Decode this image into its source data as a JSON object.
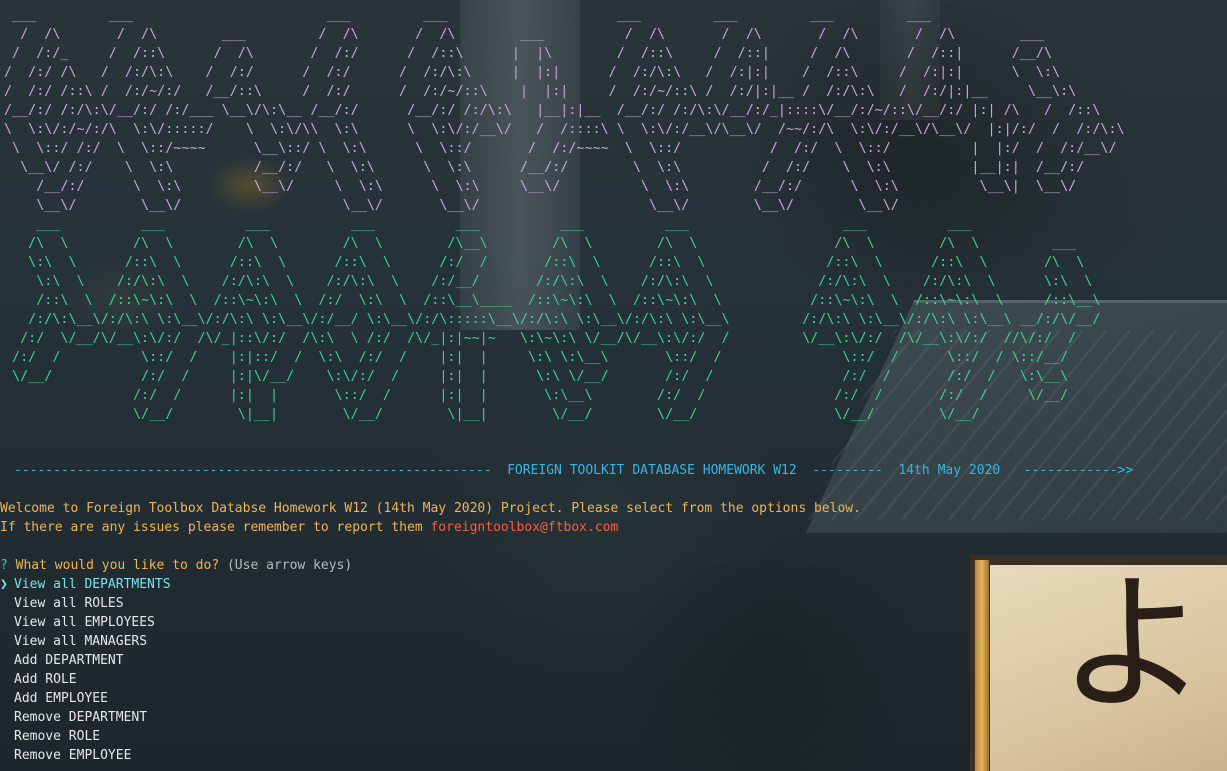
{
  "colors": {
    "ascii_top": "#c9a3e0",
    "ascii_bottom": "#3cd38a",
    "divider": "#36b7e2",
    "welcome": "#f0b455",
    "email": "#ff5c3c",
    "prompt_mark": "#3cd38a",
    "prompt_question": "#f0b455",
    "hint": "#b8b8b8",
    "selected": "#7fe0ea",
    "text": "#e8e8e8",
    "background_lantern_text": "#2a1f18"
  },
  "banner_top": " ___         ___                        ___         ___                     ___         ___         ___         ___\n  /  /\\       /  /\\        ___         /  /\\       /  /\\        ___          /  /\\       /  /\\       /  /\\       /  /\\        ___\n /  /:/_     /  /::\\      /  /\\       /  /:/      /  /::\\      |  |\\        /  /::\\     /  /::|     /  /\\       /  /::|      /__/\\\n/  /:/ /\\   /  /:/\\:\\    /  /:/      /  /:/      /  /:/\\:\\     |  |:|      /  /:/\\:\\   /  /:|:|    /  /::\\     /  /:|:|      \\  \\:\\\n/  /:/ /::\\ /  /:/~/:/   /__/::\\     /  /:/      /  /:/~/::\\    |  |:|     /  /:/~/::\\ /  /:/|:|__ /  /:/\\:\\   /  /:/|:|__     \\__\\:\\\n/__/:/ /:/\\:\\/__/:/ /:/___ \\__\\/\\:\\__ /__/:/      /__/:/ /:/\\:\\   |__|:|__  /__/:/ /:/\\:\\/__/:/_|::::\\/__/:/~/::\\/__/:/ |:| /\\   /  /::\\\n\\  \\:\\/:/~/:/\\  \\:\\/:::::/    \\  \\:\\/\\\\  \\:\\      \\  \\:\\/:/__\\/   /  /::::\\ \\  \\:\\/:/__\\/\\__\\/  /~~/:/\\  \\:\\/:/__\\/\\__\\/  |:|/:/  /  /:/\\:\\\n \\  \\::/ /:/  \\  \\::/~~~~      \\__\\::/ \\  \\:\\      \\  \\::/       /  /:/~~~~  \\  \\::/           /  /:/  \\  \\::/          |  |:/  /  /:/__\\/\n  \\__\\/ /:/    \\  \\:\\          /__/:/   \\  \\:\\      \\  \\:\\      /__/:/        \\  \\:\\          /  /:/    \\  \\:\\          |__|:|  /__/:/\n    /__/:/      \\  \\:\\         \\__\\/     \\  \\:\\      \\  \\:\\     \\__\\/          \\  \\:\\        /__/:/      \\  \\:\\          \\__\\|  \\__\\/\n    \\__\\/        \\__\\/                    \\__\\/       \\__\\/                     \\__\\/        \\__\\/        \\__\\/",
  "banner_bottom": "    ___          ___          ___          ___          ___          ___          ___                   ___          ___\n   /\\  \\        /\\  \\        /\\  \\        /\\  \\        /\\__\\        /\\  \\        /\\  \\                 /\\  \\        /\\  \\         ___\n   \\:\\  \\      /::\\  \\      /::\\  \\      /::\\  \\      /:/  /       /::\\  \\      /::\\  \\               /::\\  \\      /::\\  \\       /\\  \\\n    \\:\\  \\    /:/\\:\\  \\    /:/\\:\\  \\    /:/\\:\\  \\    /:/__/       /:/\\:\\  \\    /:/\\:\\  \\             /:/\\:\\  \\    /:/\\:\\  \\      \\:\\  \\\n    /::\\  \\  /::\\~\\:\\  \\  /::\\~\\:\\  \\  /:/  \\:\\  \\  /::\\__\\____  /::\\~\\:\\  \\  /::\\~\\:\\  \\           /::\\~\\:\\  \\  /::\\~\\:\\  \\     /::\\__\\\n   /:/\\:\\__\\/:/\\:\\ \\:\\__\\/:/\\:\\ \\:\\__\\/:/__/ \\:\\__\\/:/\\:::::\\__\\/:/\\:\\ \\:\\__\\/:/\\:\\ \\:\\__\\         /:/\\:\\ \\:\\__\\/:/\\:\\ \\:\\__\\ __/:/\\/__/\n  /:/  \\/__/\\/__\\:\\/:/  /\\/_|::\\/:/  /\\:\\  \\ /:/  /\\/_|:|~~|~   \\:\\~\\:\\ \\/__/\\/__\\:\\/:/  /         \\/__\\:\\/:/  /\\/__\\:\\/:/  //\\/:/  /\n /:/  /          \\::/  /    |:|::/  /  \\:\\  /:/  /    |:|  |     \\:\\ \\:\\__\\       \\::/  /               \\::/  /      \\::/  / \\::/__/\n \\/__/           /:/  /     |:|\\/__/    \\:\\/:/  /     |:|  |      \\:\\ \\/__/       /:/  /                /:/  /       /:/  /   \\:\\__\\\n                /:/  /      |:|  |       \\::/  /      |:|  |       \\:\\__\\        /:/  /                /:/  /       /:/  /     \\/__/\n                \\/__/        \\|__|        \\/__/        \\|__|        \\/__/        \\/__/                 \\/__/        \\/__/",
  "divider": {
    "left_dashes": "-------------------------------------------------------------",
    "title": "FOREIGN TOOLKIT DATABASE HOMEWORK W12",
    "mid_dashes": "---------",
    "date": "14th May 2020",
    "right_arrow": "------------>>"
  },
  "welcome": {
    "line1": "Welcome to Foreign Toolbox Databse Homework W12 (14th May 2020) Project. Please select from the options below.",
    "line2_prefix": "If there are any issues please remember to report them ",
    "email": "foreigntoolbox@ftbox.com"
  },
  "prompt": {
    "mark": "?",
    "question": "What would you like to do?",
    "hint": "(Use arrow keys)"
  },
  "menu": {
    "pointer": "❯",
    "items": [
      "View all DEPARTMENTS",
      "View all ROLES",
      "View all EMPLOYEES",
      "View all MANAGERS",
      "Add DEPARTMENT",
      "Add ROLE",
      "Add EMPLOYEE",
      "Remove DEPARTMENT",
      "Remove ROLE",
      "Remove EMPLOYEE"
    ],
    "selected_index": 0
  },
  "background": {
    "lantern_text": "よし"
  }
}
